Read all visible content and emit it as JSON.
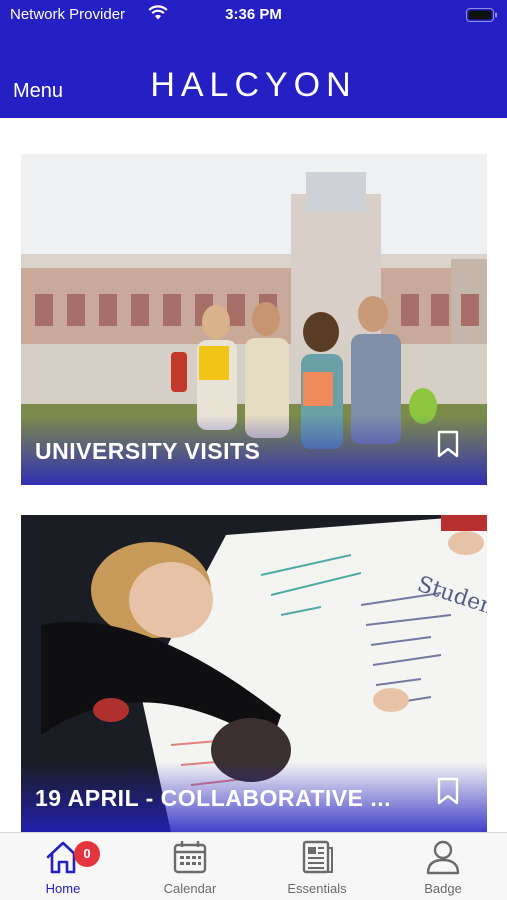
{
  "status_bar": {
    "carrier": "Network Provider",
    "time": "3:36 PM"
  },
  "header": {
    "menu_label": "Menu",
    "brand": "HALCYON"
  },
  "colors": {
    "brand_blue": "#2420c4",
    "notification_red": "#e6343f"
  },
  "feed": {
    "cards": [
      {
        "title": "UNIVERSITY VISITS",
        "icon": "bookmark-icon"
      },
      {
        "title": "19 APRIL - COLLABORATIVE ...",
        "icon": "bookmark-icon"
      }
    ]
  },
  "tabbar": {
    "tabs": [
      {
        "label": "Home",
        "icon": "home-icon",
        "active": true,
        "badge": "0"
      },
      {
        "label": "Calendar",
        "icon": "calendar-icon",
        "active": false
      },
      {
        "label": "Essentials",
        "icon": "essentials-icon",
        "active": false
      },
      {
        "label": "Badge",
        "icon": "person-icon",
        "active": false
      }
    ]
  }
}
